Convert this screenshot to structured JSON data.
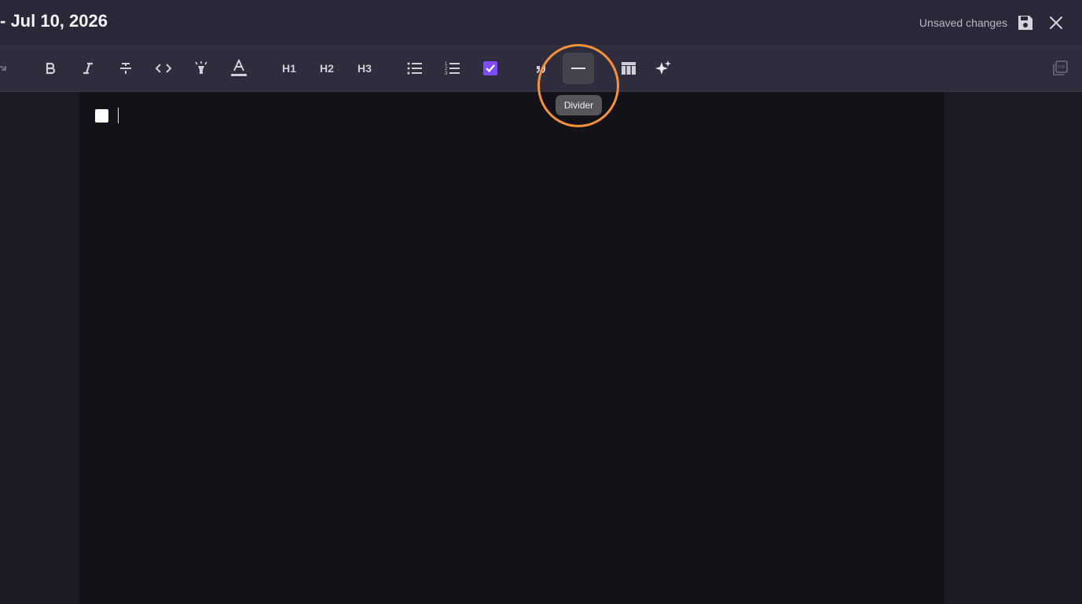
{
  "header": {
    "title": "- Jul 10, 2026",
    "status": "Unsaved changes"
  },
  "toolbar": {
    "items": [
      {
        "name": "redo-icon"
      },
      {
        "name": "bold-icon"
      },
      {
        "name": "italic-icon"
      },
      {
        "name": "strikethrough-icon"
      },
      {
        "name": "code-icon"
      },
      {
        "name": "highlight-icon"
      },
      {
        "name": "text-color-icon"
      },
      {
        "label": "H1"
      },
      {
        "label": "H2"
      },
      {
        "label": "H3"
      },
      {
        "name": "bullet-list-icon"
      },
      {
        "name": "numbered-list-icon"
      },
      {
        "name": "task-list-icon"
      },
      {
        "name": "quote-icon"
      },
      {
        "name": "divider-icon"
      },
      {
        "name": "table-icon"
      },
      {
        "name": "ai-sparkle-icon"
      },
      {
        "name": "pdf-export-icon"
      }
    ],
    "tooltip": "Divider"
  },
  "colors": {
    "accent_purple": "#7c4dff",
    "highlight_ring": "#f5913a"
  }
}
